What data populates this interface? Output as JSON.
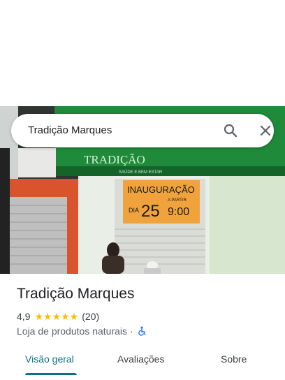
{
  "search": {
    "query": "Tradição Marques"
  },
  "photo": {
    "sign_name": "TRADIÇÃO",
    "sign_tagline": "SAÚDE E BEM ESTAR",
    "banner_line1": "INAUGURAÇÃO",
    "banner_dia": "DIA",
    "banner_day": "25",
    "banner_from": "A PARTIR",
    "banner_time": "9:00"
  },
  "place": {
    "name": "Tradição Marques",
    "rating": "4,9",
    "stars": "★★★★★",
    "review_count": "(20)",
    "category": "Loja de produtos naturais",
    "separator": "·"
  },
  "tabs": [
    {
      "label": "Visão geral",
      "active": true
    },
    {
      "label": "Avaliações",
      "active": false
    },
    {
      "label": "Sobre",
      "active": false
    }
  ],
  "colors": {
    "accent": "#0b7285",
    "star": "#fbbc04",
    "sign_green": "#1e8a3a",
    "banner_orange": "#f0a33c",
    "accessibility_blue": "#1a73e8"
  }
}
